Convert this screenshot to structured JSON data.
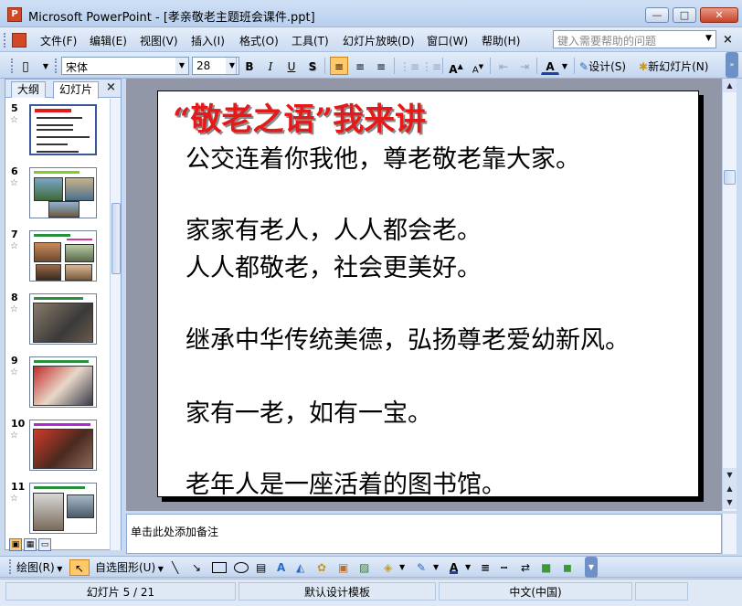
{
  "window": {
    "title": "Microsoft PowerPoint - [孝亲敬老主题班会课件.ppt]",
    "minimize": "—",
    "maximize": "□",
    "close": "✕"
  },
  "menu": {
    "items": [
      "文件(F)",
      "编辑(E)",
      "视图(V)",
      "插入(I)",
      "格式(O)",
      "工具(T)",
      "幻灯片放映(D)",
      "窗口(W)",
      "帮助(H)"
    ],
    "help_placeholder": "键入需要帮助的问题"
  },
  "toolbar": {
    "font": "宋体",
    "size": "28",
    "bold": "B",
    "italic": "I",
    "underline": "U",
    "shadow": "S",
    "design_label": "设计(S)",
    "new_slide_label": "新幻灯片(N)"
  },
  "panel": {
    "tabs": [
      "大纲",
      "幻灯片"
    ],
    "close": "×",
    "thumbnails": [
      {
        "num": "5",
        "selected": true
      },
      {
        "num": "6",
        "selected": false
      },
      {
        "num": "7",
        "selected": false
      },
      {
        "num": "8",
        "selected": false
      },
      {
        "num": "9",
        "selected": false
      },
      {
        "num": "10",
        "selected": false
      },
      {
        "num": "11",
        "selected": false
      }
    ]
  },
  "slide": {
    "title": "“敬老之语”我来讲",
    "lines": [
      "公交连着你我他，尊老敬老靠大家。",
      "家家有老人，人人都会老。",
      "人人都敬老，社会更美好。",
      "继承中华传统美德，弘扬尊老爱幼新风。",
      "家有一老，如有一宝。",
      "老年人是一座活着的图书馆。"
    ]
  },
  "notes": {
    "placeholder": "单击此处添加备注"
  },
  "drawbar": {
    "draw_label": "绘图(R)",
    "autoshapes_label": "自选图形(U)"
  },
  "status": {
    "slide_info": "幻灯片 5 / 21",
    "template": "默认设计模板",
    "language": "中文(中国)"
  },
  "colors": {
    "title_red": "#e41a1a",
    "editor_bg": "#9297a8",
    "accent_orange": "#ffc86a"
  }
}
